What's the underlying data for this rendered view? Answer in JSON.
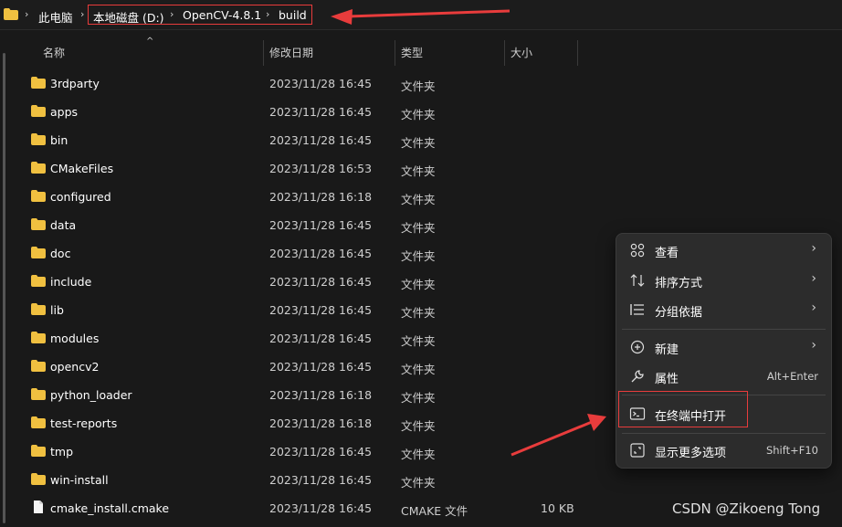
{
  "breadcrumb": {
    "root": "此电脑",
    "items": [
      "本地磁盘 (D:)",
      "OpenCV-4.8.1",
      "build"
    ]
  },
  "columns": {
    "name": "名称",
    "date": "修改日期",
    "type": "类型",
    "size": "大小"
  },
  "files": [
    {
      "name": "3rdparty",
      "date": "2023/11/28 16:45",
      "type": "文件夹",
      "size": "",
      "icon": "folder-icon"
    },
    {
      "name": "apps",
      "date": "2023/11/28 16:45",
      "type": "文件夹",
      "size": "",
      "icon": "folder-icon"
    },
    {
      "name": "bin",
      "date": "2023/11/28 16:45",
      "type": "文件夹",
      "size": "",
      "icon": "folder-icon"
    },
    {
      "name": "CMakeFiles",
      "date": "2023/11/28 16:53",
      "type": "文件夹",
      "size": "",
      "icon": "folder-icon"
    },
    {
      "name": "configured",
      "date": "2023/11/28 16:18",
      "type": "文件夹",
      "size": "",
      "icon": "folder-icon"
    },
    {
      "name": "data",
      "date": "2023/11/28 16:45",
      "type": "文件夹",
      "size": "",
      "icon": "folder-icon"
    },
    {
      "name": "doc",
      "date": "2023/11/28 16:45",
      "type": "文件夹",
      "size": "",
      "icon": "folder-icon"
    },
    {
      "name": "include",
      "date": "2023/11/28 16:45",
      "type": "文件夹",
      "size": "",
      "icon": "folder-icon"
    },
    {
      "name": "lib",
      "date": "2023/11/28 16:45",
      "type": "文件夹",
      "size": "",
      "icon": "folder-icon"
    },
    {
      "name": "modules",
      "date": "2023/11/28 16:45",
      "type": "文件夹",
      "size": "",
      "icon": "folder-icon"
    },
    {
      "name": "opencv2",
      "date": "2023/11/28 16:45",
      "type": "文件夹",
      "size": "",
      "icon": "folder-icon"
    },
    {
      "name": "python_loader",
      "date": "2023/11/28 16:18",
      "type": "文件夹",
      "size": "",
      "icon": "folder-icon"
    },
    {
      "name": "test-reports",
      "date": "2023/11/28 16:18",
      "type": "文件夹",
      "size": "",
      "icon": "folder-icon"
    },
    {
      "name": "tmp",
      "date": "2023/11/28 16:45",
      "type": "文件夹",
      "size": "",
      "icon": "folder-icon"
    },
    {
      "name": "win-install",
      "date": "2023/11/28 16:45",
      "type": "文件夹",
      "size": "",
      "icon": "folder-icon"
    },
    {
      "name": "cmake_install.cmake",
      "date": "2023/11/28 16:45",
      "type": "CMAKE 文件",
      "size": "10 KB",
      "icon": "file-icon"
    }
  ],
  "context_menu": {
    "view": "查看",
    "sort": "排序方式",
    "group": "分组依据",
    "new": "新建",
    "properties": "属性",
    "properties_shortcut": "Alt+Enter",
    "open_terminal": "在终端中打开",
    "more_options": "显示更多选项",
    "more_options_shortcut": "Shift+F10"
  },
  "watermark": "CSDN @Zikoeng Tong",
  "colors": {
    "background": "#191919",
    "folder": "#f0c040",
    "annotation": "#e83c3c",
    "menu": "#2c2c2c"
  }
}
